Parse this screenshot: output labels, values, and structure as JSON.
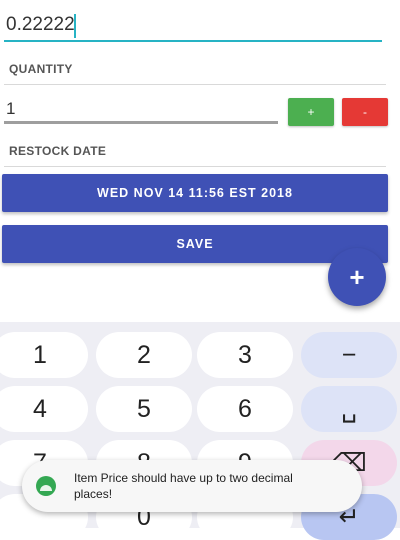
{
  "form": {
    "price_value": "0.22222",
    "quantity_label": "QUANTITY",
    "quantity_value": "1",
    "plus_label": "+",
    "minus_label": "-",
    "restock_label": "RESTOCK DATE",
    "restock_button": "WED NOV 14 11:56 EST 2018",
    "save_button": "SAVE"
  },
  "fab": {
    "label": "+"
  },
  "keyboard": {
    "keys": [
      "1",
      "2",
      "3",
      "−",
      "4",
      "5",
      "6",
      "␣",
      "7",
      "8",
      "9",
      "⌫",
      "",
      "0",
      "",
      "↵"
    ]
  },
  "toast": {
    "message": "Item Price should have up to two decimal places!"
  },
  "colors": {
    "primary": "#3f51b5",
    "accent_underline": "#26b3c4",
    "plus_green": "#4caf50",
    "minus_red": "#e53935"
  }
}
